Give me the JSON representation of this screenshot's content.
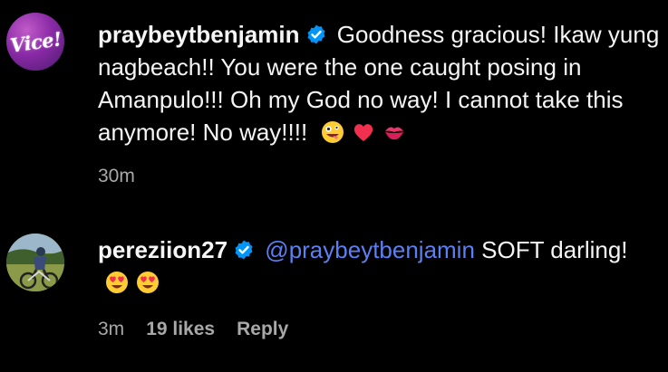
{
  "comments": [
    {
      "username": "praybeytbenjamin",
      "avatar_logo": "Vice!",
      "text": "Goodness gracious! Ikaw yung nagbeach!! You were the one caught posing in Amanpulo!!! Oh my God no way! I cannot take this anymore! No way!!!!",
      "emojis": [
        "zany-face-emoji",
        "red-heart-emoji",
        "kiss-mark-emoji"
      ],
      "time": "30m"
    },
    {
      "username": "pereziion27",
      "mention": "@praybeytbenjamin",
      "text": "SOFT darling!",
      "emojis": [
        "heart-eyes-emoji",
        "heart-eyes-emoji"
      ],
      "time": "3m",
      "likes": "19 likes",
      "reply_label": "Reply"
    }
  ],
  "colors": {
    "background": "#000000",
    "text": "#f5f5f5",
    "muted": "#a8a8a8",
    "mention": "#5b80f5",
    "verified": "#0095f6"
  }
}
